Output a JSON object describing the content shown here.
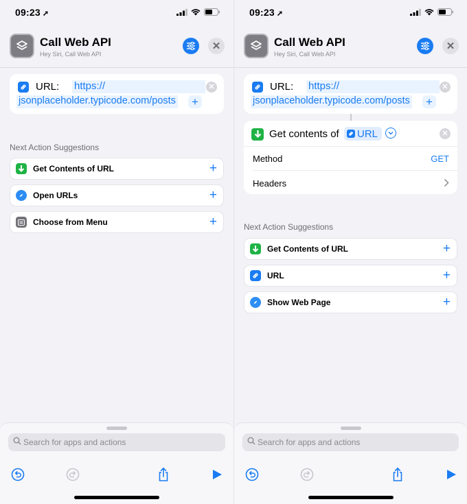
{
  "status": {
    "time": "09:23"
  },
  "header": {
    "title": "Call Web API",
    "subtitle": "Hey Siri, Call Web API"
  },
  "url_action": {
    "label": "URL:",
    "value_line1": "https://",
    "value_line2": "jsonplaceholder.typicode.com/posts"
  },
  "get_contents": {
    "label": "Get contents of",
    "variable": "URL",
    "method_label": "Method",
    "method_value": "GET",
    "headers_label": "Headers"
  },
  "suggestions_title": "Next Action Suggestions",
  "left_suggestions": [
    "Get Contents of URL",
    "Open URLs",
    "Choose from Menu"
  ],
  "right_suggestions": [
    "Get Contents of URL",
    "URL",
    "Show Web Page"
  ],
  "search": {
    "placeholder": "Search for apps and actions"
  },
  "colors": {
    "accent": "#1a7cf2",
    "green": "#1fb345"
  }
}
